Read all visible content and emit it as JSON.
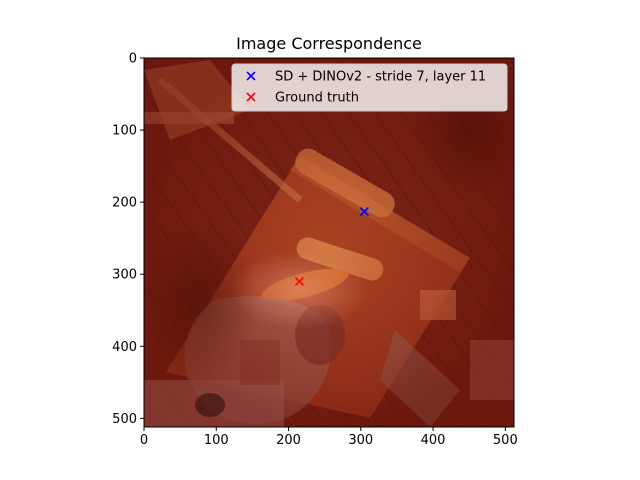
{
  "chart_data": {
    "type": "scatter",
    "title": "Image Correspondence",
    "xlabel": "",
    "ylabel": "",
    "xlim": [
      0,
      512
    ],
    "ylim": [
      512,
      0
    ],
    "x_ticks": [
      0,
      100,
      200,
      300,
      400,
      500
    ],
    "y_ticks": [
      0,
      100,
      200,
      300,
      400,
      500
    ],
    "background": "photo of wooden planks and cut fruit/vegetable slices on a wooden board under a red heatmap overlay",
    "legend_position": "top-right",
    "series": [
      {
        "name": "SD + DINOv2 - stride 7, layer 11",
        "marker": "x",
        "color": "#0000ff",
        "points": [
          {
            "x": 305,
            "y": 213
          }
        ]
      },
      {
        "name": "Ground truth",
        "marker": "x",
        "color": "#ff0000",
        "points": [
          {
            "x": 215,
            "y": 310
          }
        ]
      }
    ]
  }
}
